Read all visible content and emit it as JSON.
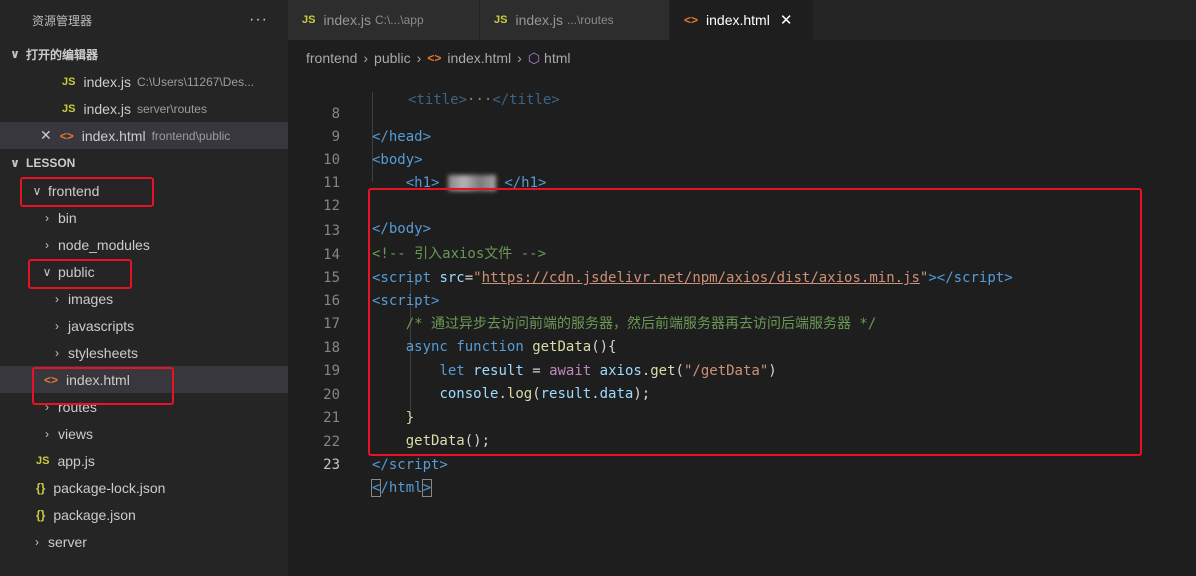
{
  "explorer": {
    "title": "资源管理器",
    "more": "···",
    "open_editors_label": "打开的编辑器",
    "open_editors": [
      {
        "name": "index.js",
        "desc": "C:\\Users\\11267\\Des..."
      },
      {
        "name": "index.js",
        "desc": "server\\routes"
      },
      {
        "name": "index.html",
        "desc": "frontend\\public"
      }
    ],
    "project_label": "LESSON",
    "tree": {
      "frontend": "frontend",
      "bin": "bin",
      "node_modules": "node_modules",
      "public": "public",
      "images": "images",
      "javascripts": "javascripts",
      "stylesheets": "stylesheets",
      "index_html": "index.html",
      "routes": "routes",
      "views": "views",
      "app_js": "app.js",
      "package_lock": "package-lock.json",
      "package_json": "package.json",
      "server": "server"
    }
  },
  "tabs": [
    {
      "name": "index.js",
      "desc": "C:\\...\\app"
    },
    {
      "name": "index.js",
      "desc": "...\\routes"
    },
    {
      "name": "index.html",
      "desc": ""
    }
  ],
  "breadcrumb": [
    "frontend",
    "public",
    "index.html",
    "html"
  ],
  "editor": {
    "line_numbers": [
      "8",
      "9",
      "10",
      "11",
      "12",
      "13",
      "14",
      "15",
      "16",
      "17",
      "18",
      "19",
      "20",
      "21",
      "22",
      "23"
    ],
    "l13_comment": "<!-- 引入axios文件 -->",
    "l14_src_attr": "src",
    "l14_url": "https://cdn.jsdelivr.net/npm/axios/dist/axios.min.js",
    "l16_comment": "/* 通过异步去访问前端的服务器，然后前端服务器再去访问后端服务器 */",
    "l17_async": "async",
    "l17_function": "function",
    "l17_fn": "getData",
    "l18_let": "let",
    "l18_var": "result",
    "l18_await": "await",
    "l18_axios": "axios",
    "l18_get": "get",
    "l18_str": "\"/getData\"",
    "l19_console": "console",
    "l19_log": "log",
    "l19_arg": "result.data",
    "l21_call": "getData"
  }
}
